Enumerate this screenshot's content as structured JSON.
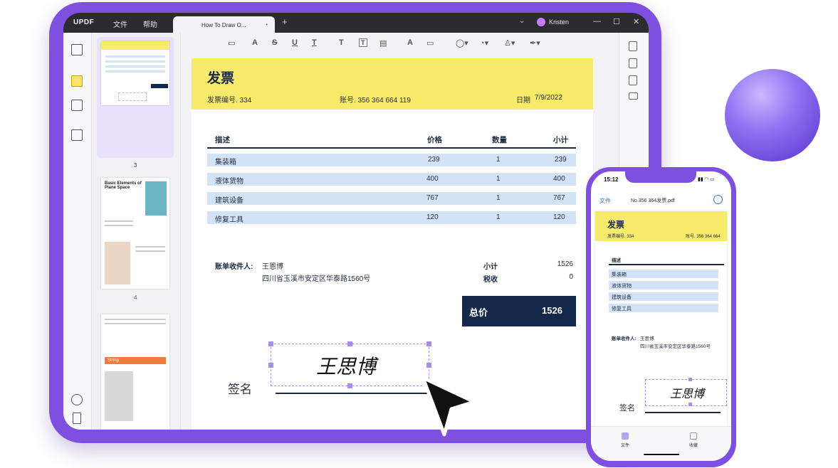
{
  "app": {
    "logo": "UPDF",
    "menu": [
      "文件",
      "帮助"
    ],
    "tab_title": "How To Draw O...",
    "tab_close": "•",
    "new_tab": "+",
    "user": "Kristen",
    "window_controls": [
      "—",
      "☐",
      "✕"
    ]
  },
  "thumbnails": {
    "pages": [
      "3",
      "4"
    ],
    "page4_title": "Basic Elements of Plane Space",
    "page5_heading": "String"
  },
  "toolbar": {
    "tools": [
      "A",
      "S",
      "U",
      "T",
      "T",
      "T",
      "A"
    ]
  },
  "invoice": {
    "title": "发票",
    "number_label": "发票编号. 334",
    "account_label": "账号. 356 364 664 119",
    "date_label": "日期",
    "date_value": "7/9/2022",
    "headers": [
      "描述",
      "价格",
      "数量",
      "小计"
    ],
    "items": [
      {
        "desc": "集装箱",
        "price": "239",
        "qty": "1",
        "subtotal": "239"
      },
      {
        "desc": "液体货物",
        "price": "400",
        "qty": "1",
        "subtotal": "400"
      },
      {
        "desc": "建筑设备",
        "price": "767",
        "qty": "1",
        "subtotal": "767"
      },
      {
        "desc": "修复工具",
        "price": "120",
        "qty": "1",
        "subtotal": "120"
      }
    ],
    "bill_to_label": "账单收件人:",
    "bill_to_name": "王恩博",
    "bill_to_address": "四川省玉溪市安定区华泰路1560号",
    "subtotal_label": "小计",
    "subtotal_value": "1526",
    "tax_label": "税收",
    "tax_value": "0",
    "total_label": "总价",
    "total_value": "1526",
    "signature_label": "签名",
    "signature_text": "王思博"
  },
  "phone": {
    "time": "15:12",
    "back_label": "文件",
    "file_name": "No.356 364发票.pdf",
    "invoice_title": "发票",
    "number_label": "发票编号. 334",
    "account_label": "账号. 356 364 664",
    "desc_header": "描述",
    "items": [
      "集装箱",
      "液体货物",
      "建筑设备",
      "修复工具"
    ],
    "bill_to_label": "账单收件人:",
    "bill_to_name": "王思博",
    "bill_to_address": "四川省玉溪市安定区华泰路1560号",
    "signature_label": "签名",
    "signature_text": "王思博",
    "tabs": [
      "文件",
      "收藏"
    ]
  },
  "colors": {
    "frame": "#7f4fe0",
    "header_yellow": "#f8ea6b",
    "navy": "#13284a",
    "row_blue": "#d2e3f8"
  }
}
